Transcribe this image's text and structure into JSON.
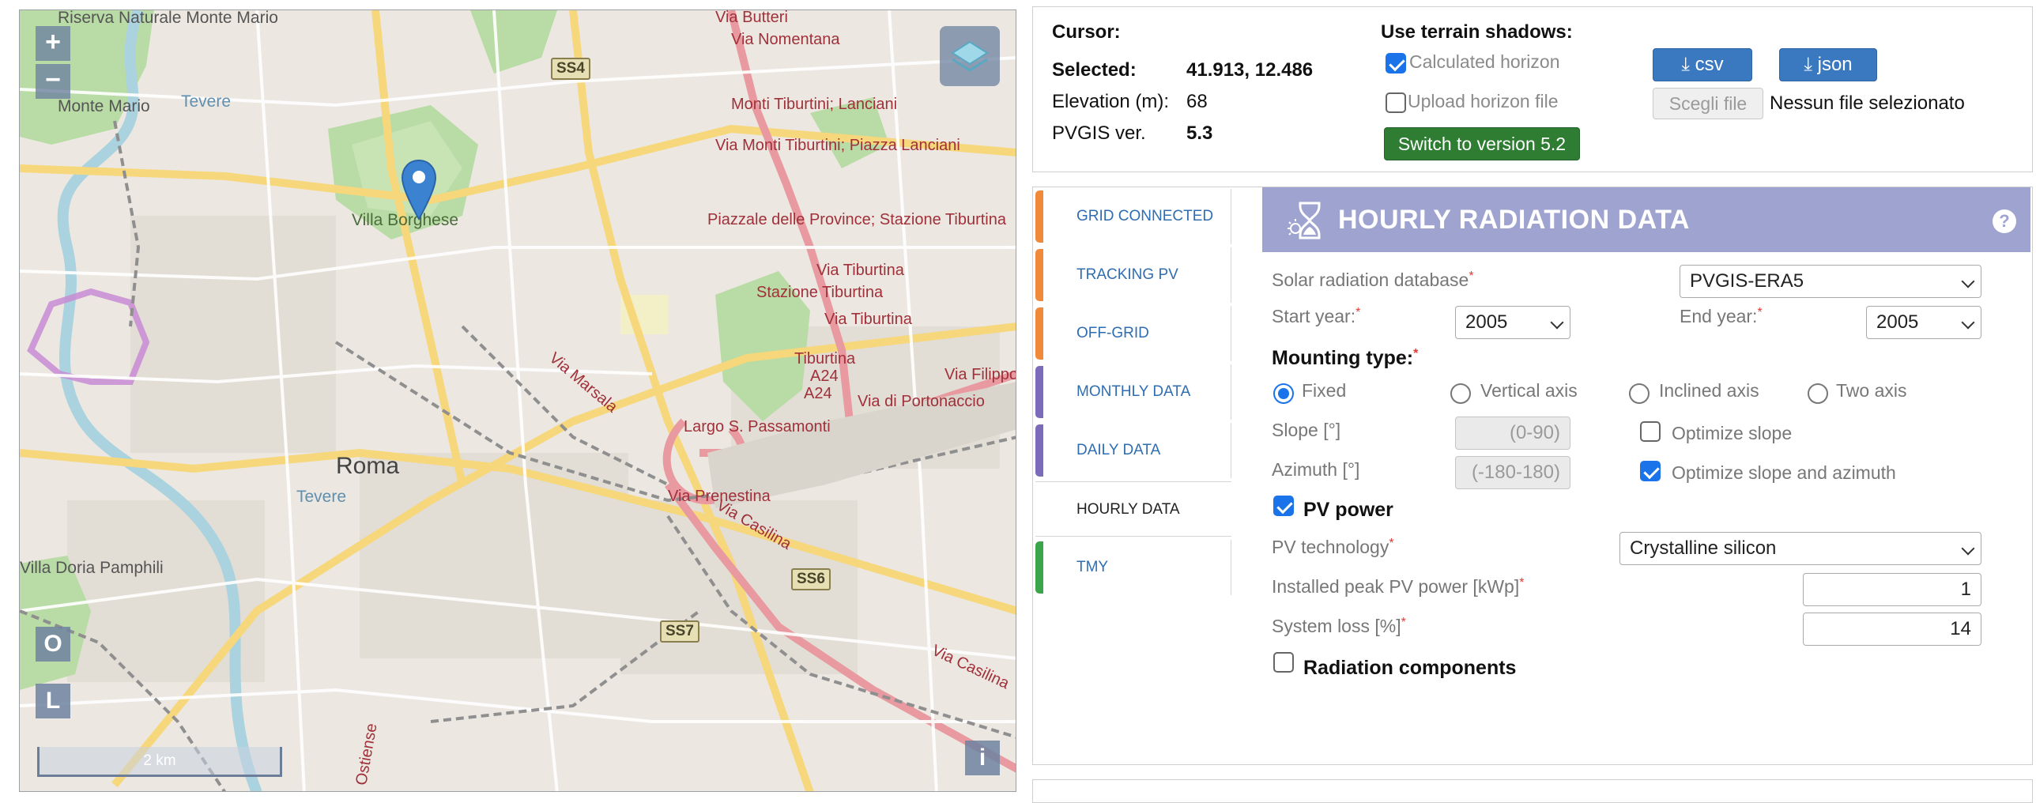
{
  "map": {
    "zoom_in": "+",
    "zoom_out": "−",
    "btn_o": "O",
    "btn_l": "L",
    "info": "i",
    "scale": "2 km",
    "labels": {
      "city": "Roma",
      "villa_borghese": "Villa Borghese",
      "monte_mario": "Monte Mario",
      "riserva": "Riserva Naturale Monte Mario",
      "villa_doria": "Villa Doria Pamphili",
      "via_nomentana": "Via Nomentana",
      "monti_tiburtini_1": "Monti Tiburtini; Lanciani",
      "monti_tiburtini_2": "Via Monti Tiburtini; Piazza Lanciani",
      "piazzale_province": "Piazzale delle Province; Stazione Tiburtina",
      "via_tiburtina_1": "Via Tiburtina",
      "stazione_tiburtina": "Stazione Tiburtina",
      "via_tiburtina_2": "Via Tiburtina",
      "tiburtina_a24": "Tiburtina",
      "a24_1": "A24",
      "a24_2": "A24",
      "via_filippo": "Via Filippo",
      "via_portonaccio": "Via di Portonaccio",
      "largo_passamonti": "Largo S. Passamonti",
      "via_prenestina": "Via Prenestina",
      "via_casilina": "Via Casilina",
      "via_casilina_2": "Via Casilina",
      "via_marsala": "Via Marsala",
      "ostiense": "Ostiense",
      "tevere_1": "Tevere",
      "tevere_2": "Tevere",
      "via_butteri": "Via Butteri"
    },
    "shields": {
      "ss4": "SS4",
      "ss6": "SS6",
      "ss7": "SS7"
    }
  },
  "top": {
    "cursor_label": "Cursor:",
    "selected_label": "Selected:",
    "selected_value": "41.913, 12.486",
    "elevation_label": "Elevation (m):",
    "elevation_value": "68",
    "pvgis_label": "PVGIS ver.",
    "pvgis_value": "5.3",
    "terrain_title": "Use terrain shadows:",
    "calculated_horizon": "Calculated horizon",
    "upload_horizon": "Upload horizon file",
    "switch_button": "Switch to version 5.2",
    "csv_button": "csv",
    "json_button": "json",
    "choose_file": "Scegli file",
    "no_file": "Nessun file selezionato"
  },
  "tabs": [
    {
      "label": "GRID CONNECTED",
      "color": "#f0893a"
    },
    {
      "label": "TRACKING PV",
      "color": "#f0893a"
    },
    {
      "label": "OFF-GRID",
      "color": "#f0893a"
    },
    {
      "label": "MONTHLY DATA",
      "color": "#7b6bb8"
    },
    {
      "label": "DAILY DATA",
      "color": "#7b6bb8"
    },
    {
      "label": "HOURLY DATA",
      "color": "#ffffff"
    },
    {
      "label": "TMY",
      "color": "#3aa54a"
    }
  ],
  "form": {
    "title": "HOURLY RADIATION DATA",
    "help": "?",
    "db_label": "Solar radiation database",
    "db_value": "PVGIS-ERA5",
    "start_label": "Start year:",
    "start_value": "2005",
    "end_label": "End year:",
    "end_value": "2005",
    "mounting_label": "Mounting type:",
    "mount_fixed": "Fixed",
    "mount_vertical": "Vertical axis",
    "mount_inclined": "Inclined axis",
    "mount_two": "Two axis",
    "slope_label": "Slope [°]",
    "slope_placeholder": "(0-90)",
    "azimuth_label": "Azimuth [°]",
    "azimuth_placeholder": "(-180-180)",
    "opt_slope": "Optimize slope",
    "opt_slope_azimuth": "Optimize slope and azimuth",
    "pv_power": "PV power",
    "pv_tech_label": "PV technology",
    "pv_tech_value": "Crystalline silicon",
    "peak_label": "Installed peak PV power [kWp]",
    "peak_value": "1",
    "loss_label": "System loss [%]",
    "loss_value": "14",
    "rad_components": "Radiation components",
    "required_mark": "*"
  }
}
